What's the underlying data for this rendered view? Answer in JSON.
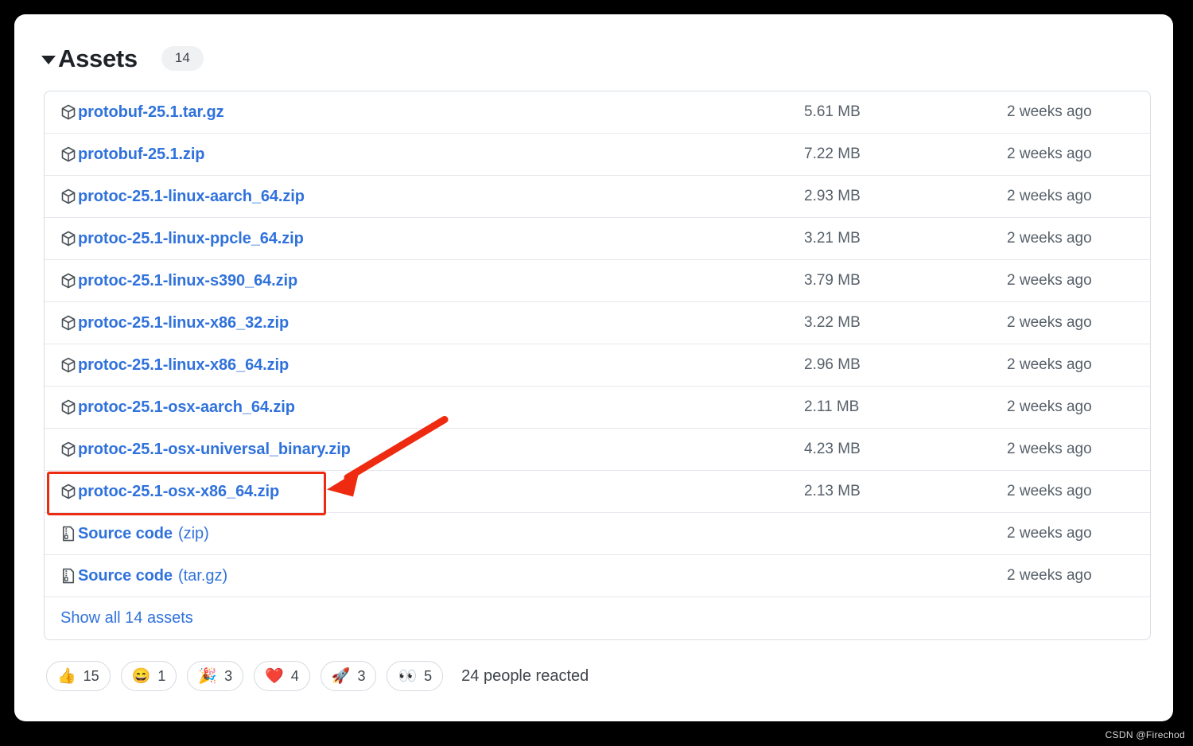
{
  "header": {
    "title": "Assets",
    "count": "14",
    "disclosure": "expanded"
  },
  "assets": [
    {
      "name": "protobuf-25.1.tar.gz",
      "suffix": "",
      "size": "5.61 MB",
      "date": "2 weeks ago",
      "icon": "package-icon",
      "highlighted": false
    },
    {
      "name": "protobuf-25.1.zip",
      "suffix": "",
      "size": "7.22 MB",
      "date": "2 weeks ago",
      "icon": "package-icon",
      "highlighted": false
    },
    {
      "name": "protoc-25.1-linux-aarch_64.zip",
      "suffix": "",
      "size": "2.93 MB",
      "date": "2 weeks ago",
      "icon": "package-icon",
      "highlighted": false
    },
    {
      "name": "protoc-25.1-linux-ppcle_64.zip",
      "suffix": "",
      "size": "3.21 MB",
      "date": "2 weeks ago",
      "icon": "package-icon",
      "highlighted": false
    },
    {
      "name": "protoc-25.1-linux-s390_64.zip",
      "suffix": "",
      "size": "3.79 MB",
      "date": "2 weeks ago",
      "icon": "package-icon",
      "highlighted": false
    },
    {
      "name": "protoc-25.1-linux-x86_32.zip",
      "suffix": "",
      "size": "3.22 MB",
      "date": "2 weeks ago",
      "icon": "package-icon",
      "highlighted": false
    },
    {
      "name": "protoc-25.1-linux-x86_64.zip",
      "suffix": "",
      "size": "2.96 MB",
      "date": "2 weeks ago",
      "icon": "package-icon",
      "highlighted": false
    },
    {
      "name": "protoc-25.1-osx-aarch_64.zip",
      "suffix": "",
      "size": "2.11 MB",
      "date": "2 weeks ago",
      "icon": "package-icon",
      "highlighted": false
    },
    {
      "name": "protoc-25.1-osx-universal_binary.zip",
      "suffix": "",
      "size": "4.23 MB",
      "date": "2 weeks ago",
      "icon": "package-icon",
      "highlighted": false
    },
    {
      "name": "protoc-25.1-osx-x86_64.zip",
      "suffix": "",
      "size": "2.13 MB",
      "date": "2 weeks ago",
      "icon": "package-icon",
      "highlighted": true
    },
    {
      "name": "Source code",
      "suffix": "(zip)",
      "size": "",
      "date": "2 weeks ago",
      "icon": "file-zip-icon",
      "highlighted": false
    },
    {
      "name": "Source code",
      "suffix": "(tar.gz)",
      "size": "",
      "date": "2 weeks ago",
      "icon": "file-zip-icon",
      "highlighted": false
    }
  ],
  "show_all": {
    "label": "Show all 14 assets"
  },
  "reactions": {
    "items": [
      {
        "emoji": "👍",
        "name": "thumbs-up-icon",
        "count": "15"
      },
      {
        "emoji": "😄",
        "name": "smile-icon",
        "count": "1"
      },
      {
        "emoji": "🎉",
        "name": "party-popper-icon",
        "count": "3"
      },
      {
        "emoji": "❤️",
        "name": "heart-icon",
        "count": "4"
      },
      {
        "emoji": "🚀",
        "name": "rocket-icon",
        "count": "3"
      },
      {
        "emoji": "👀",
        "name": "eyes-icon",
        "count": "5"
      }
    ],
    "summary": "24 people reacted"
  },
  "annotation": {
    "highlight_target": "protoc-25.1-osx-x86_64.zip",
    "color": "#ee2b11"
  },
  "watermark": "CSDN @Firechod",
  "colors": {
    "link": "#3072dc",
    "text": "#1f2328",
    "muted": "#57606a",
    "border": "#d8dde3",
    "annotation": "#ee2b11"
  }
}
